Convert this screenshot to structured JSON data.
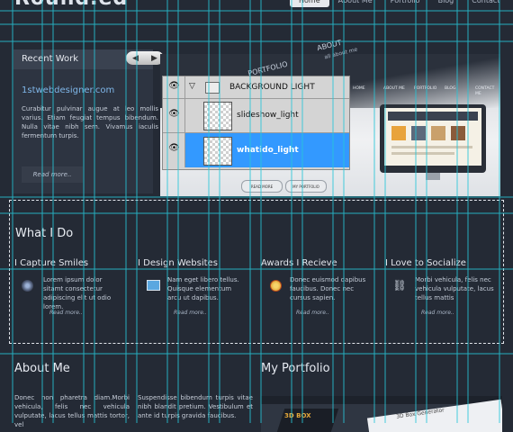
{
  "header": {
    "logo": "Round.ed",
    "nav": [
      "Home",
      "About Me",
      "Portfolio",
      "Blog",
      "Contact"
    ]
  },
  "recent_work": {
    "title": "Recent Work",
    "arrows": [
      "◀",
      "▶"
    ],
    "site_name": "1stwebdesigner.com",
    "description": "Curabitur pulvinar augue at leo mollis varius. Etiam feugiat tempus bibendum. Nulla vitae nibh sem. Vivamus iaculis fermentum turpis.",
    "read_more": "Read more.."
  },
  "slideshow": {
    "word_portfolio": "PORTFOLIO",
    "word_about": "ABOUT",
    "word_about_sub": "all about me",
    "nav": [
      "HOME",
      "ABOUT ME",
      "PORTFOLIO",
      "BLOG",
      "CONTACT ME"
    ],
    "btn_read_more": "READ MORE",
    "btn_portfolio": "MY PORTFOLIO"
  },
  "layers_panel": {
    "group": "BACKGROUND LIGHT",
    "layers": [
      "slideshow_light",
      "whatido_light"
    ],
    "selected_index": 1,
    "colors": {
      "selected": "#3399ff",
      "panel": "#d4d4d4"
    }
  },
  "what_i_do": {
    "title": "What I Do",
    "features": [
      {
        "title": "I Capture Smiles",
        "desc": "Lorem ipsum dolor sitamt consectetur adipiscing elit ut odio lorem.",
        "more": "Read more..",
        "icon": "camera-lens-icon"
      },
      {
        "title": "I Design Websites",
        "desc": "Nam eget libero tellus. Quisque elementum arcu ut dapibus.",
        "more": "Read more..",
        "icon": "monitor-icon"
      },
      {
        "title": "Awards I Recieve",
        "desc": "Donec euismod dapibus faucibus. Donec nec cursus sapien.",
        "more": "Read more..",
        "icon": "award-medal-icon"
      },
      {
        "title": "I Love to Socialize",
        "desc": "Morbi vehicula, felis nec vehicula vulputate, lacus tellus mattis",
        "more": "Read more..",
        "icon": "chain-link-icon"
      }
    ]
  },
  "about": {
    "title": "About Me",
    "col1": "Donec non pharetra diam.Morbi vehicula, felis nec vehicula vulputate, lacus tellus mattis tortor, vel",
    "col2": "Suspendisse bibendum turpis vitae nibh blandit pretium. Vestibulum et ante id turpis gravida faucibus."
  },
  "portfolio": {
    "title": "My Portfolio",
    "thumb_labels": [
      "3D BOX",
      "3D Box Generator"
    ]
  }
}
